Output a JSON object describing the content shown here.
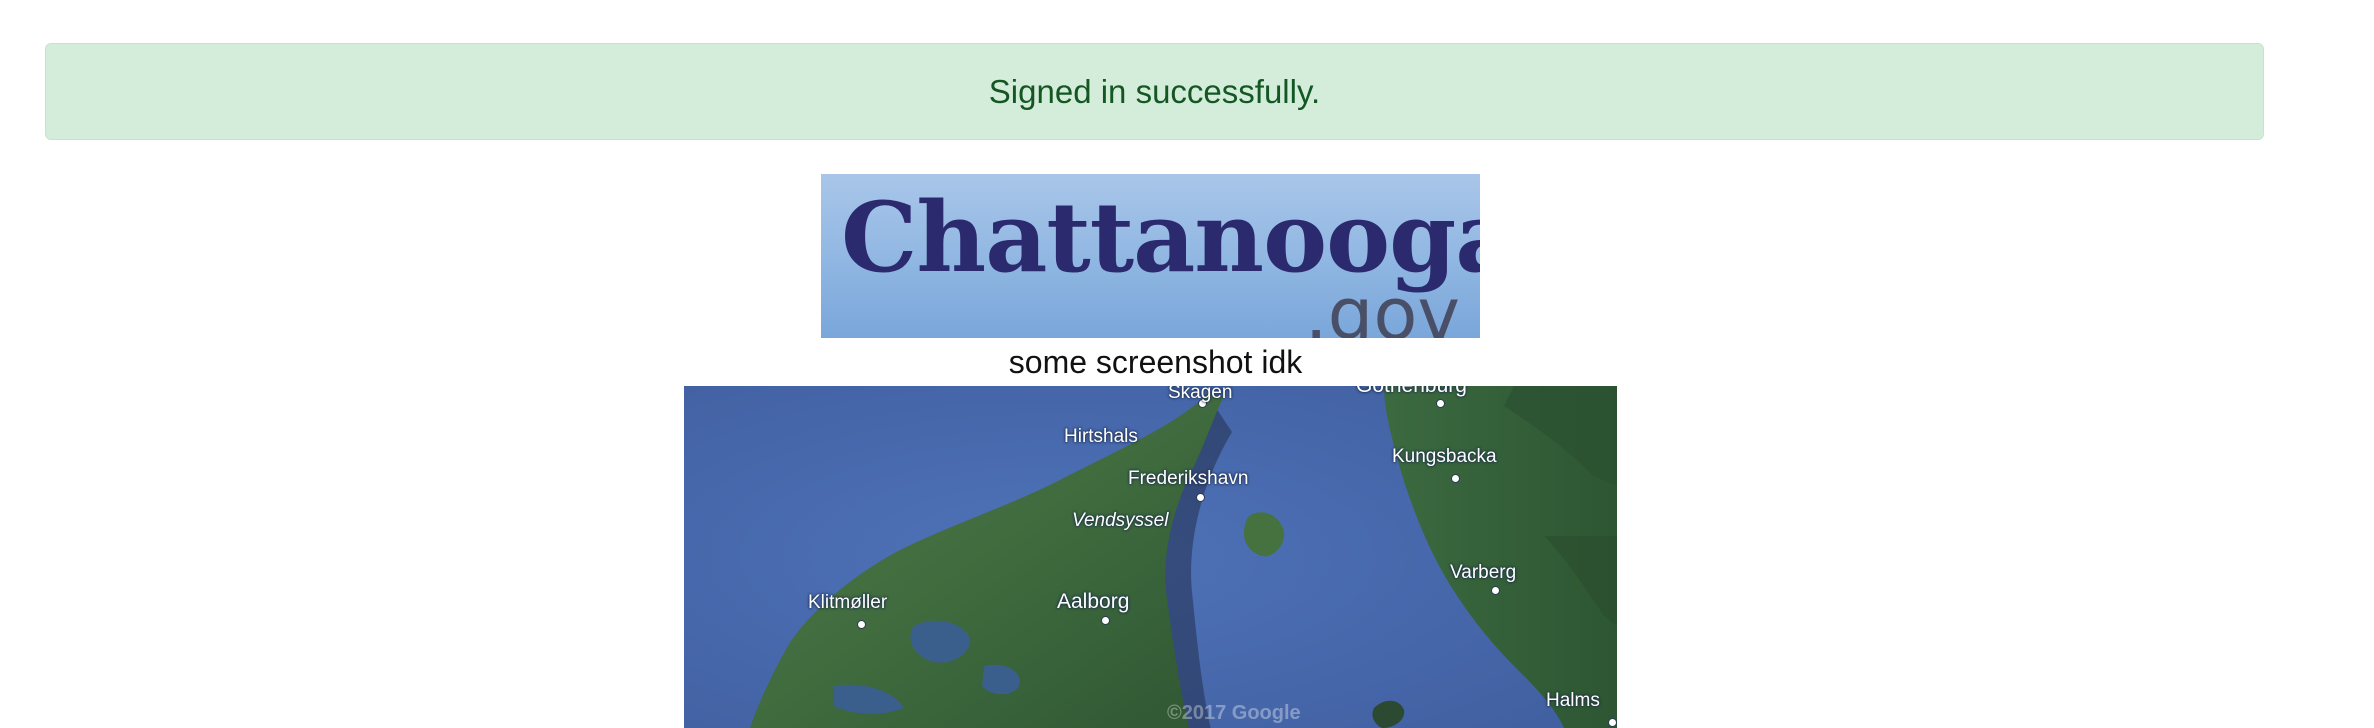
{
  "flash": {
    "message": "Signed in successfully."
  },
  "logo": {
    "main_text": "Chattanooga",
    "sub_text": ".gov"
  },
  "caption": "some screenshot idk",
  "map": {
    "labels": {
      "skagen": "Skagen",
      "gothenburg": "Gothenburg",
      "hirtshals": "Hirtshals",
      "kungsbacka": "Kungsbacka",
      "frederikshavn": "Frederikshavn",
      "vendsyssel": "Vendsyssel",
      "varberg": "Varberg",
      "klitmoller": "Klitmøller",
      "aalborg": "Aalborg",
      "halmstad": "Halms"
    },
    "watermark": "©2017 Google"
  }
}
